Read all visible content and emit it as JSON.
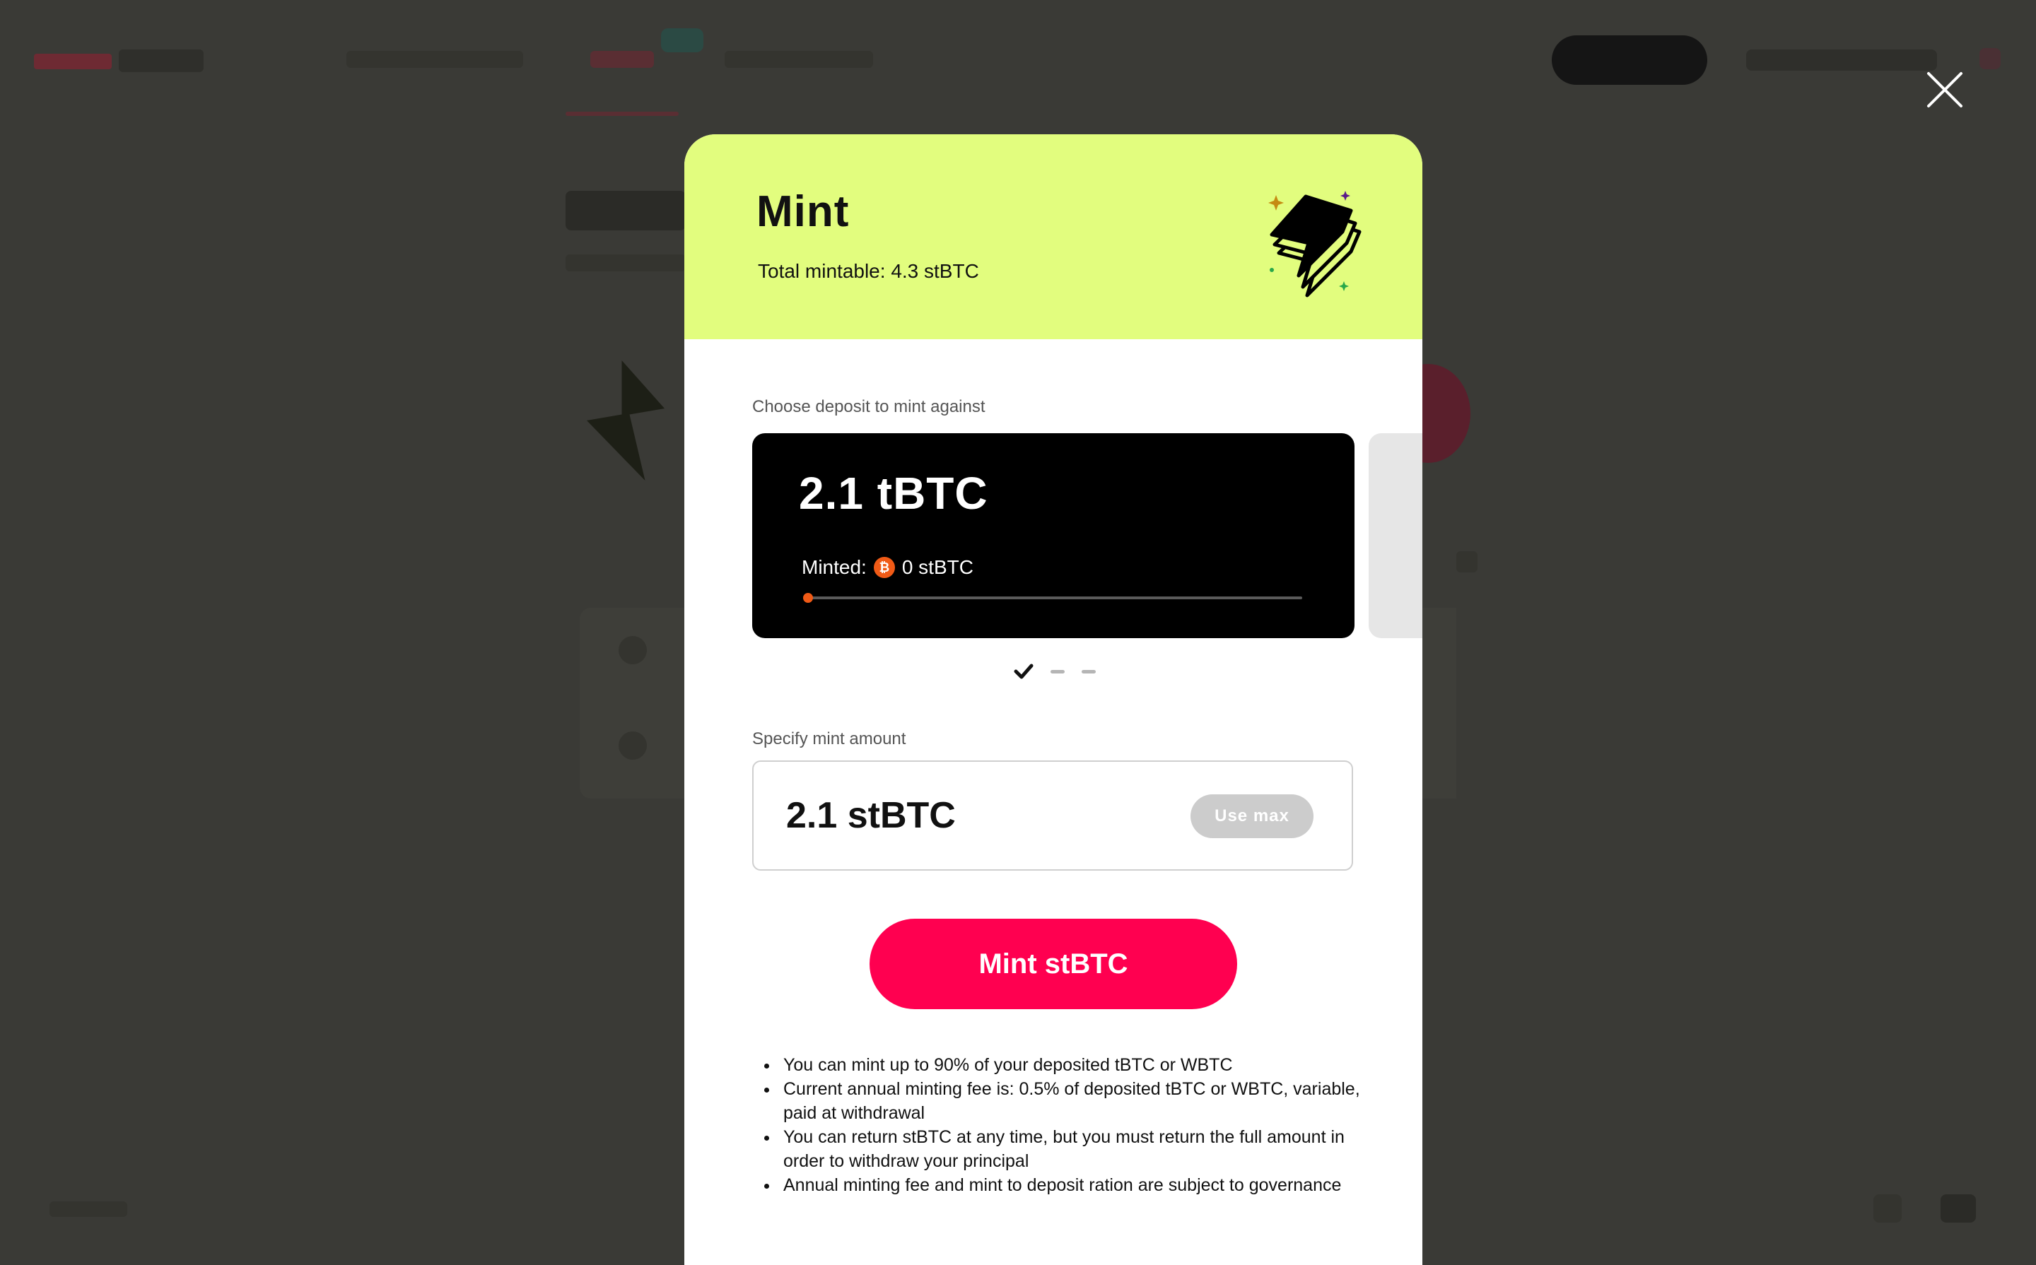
{
  "modal": {
    "title": "Mint",
    "subtitle": "Total mintable: 4.3 stBTC",
    "deposit_section_label": "Choose deposit to mint against",
    "deposit_card": {
      "amount": "2.1 tBTC",
      "minted_label": "Minted:",
      "minted_value": "0 stBTC",
      "minted_icon": "stbtc-coin-icon",
      "minted_fraction": 0
    },
    "pager": {
      "total": 3,
      "active": 0
    },
    "amount_section_label": "Specify mint amount",
    "amount_value": "2.1 stBTC",
    "use_max_label": "Use max",
    "mint_button_label": "Mint stBTC",
    "notes": [
      "You can mint up to 90% of your deposited tBTC or WBTC",
      "Current annual minting fee is: 0.5% of deposited tBTC or WBTC, variable, paid at withdrawal",
      "You can return stBTC at any time, but you must return the full amount in order to withdraw your principal",
      "Annual minting fee and mint to deposit ration are subject to governance"
    ]
  },
  "colors": {
    "header_bg": "#e2fd7e",
    "primary": "#ff0050",
    "card_bg": "#000000",
    "accent_orange": "#f05a16",
    "backdrop": "#3a3a36"
  },
  "icons": {
    "close": "close-icon",
    "header": "lightning-stack-icon",
    "pager_active": "check-icon"
  }
}
